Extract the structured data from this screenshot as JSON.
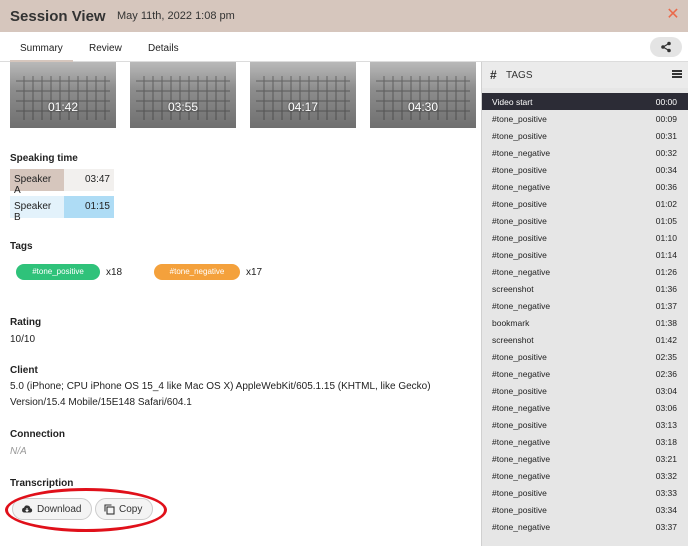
{
  "header": {
    "title": "Session View",
    "date": "May 11th, 2022 1:08 pm",
    "close_icon": "close-x-icon",
    "accent": "#ea6a4b"
  },
  "tabs": [
    {
      "label": "Summary",
      "active": true
    },
    {
      "label": "Review",
      "active": false
    },
    {
      "label": "Details",
      "active": false
    }
  ],
  "thumbnails": [
    "01:42",
    "03:55",
    "04:17",
    "04:30"
  ],
  "speaking_time": {
    "label": "Speaking time",
    "speakers": [
      {
        "name": "Speaker A",
        "duration": "03:47",
        "color": "#d6c6bd"
      },
      {
        "name": "Speaker B",
        "duration": "01:15",
        "color": "#aedcf5"
      }
    ]
  },
  "tags_summary": {
    "label": "Tags",
    "items": [
      {
        "name": "#tone_positive",
        "count": "x18",
        "color": "#2fc27a"
      },
      {
        "name": "#tone_negative",
        "count": "x17",
        "color": "#f4a13c"
      }
    ]
  },
  "rating": {
    "label": "Rating",
    "value": "10/10"
  },
  "client": {
    "label": "Client",
    "line1": "5.0 (iPhone; CPU iPhone OS 15_4 like Mac OS X) AppleWebKit/605.1.15 (KHTML, like Gecko)",
    "line2": "Version/15.4 Mobile/15E148 Safari/604.1"
  },
  "connection": {
    "label": "Connection",
    "value": "N/A"
  },
  "transcription": {
    "label": "Transcription",
    "download_label": "Download",
    "copy_label": "Copy"
  },
  "tags_panel": {
    "title": "TAGS",
    "rows": [
      {
        "name": "Video start",
        "time": "00:00",
        "active": true
      },
      {
        "name": "#tone_positive",
        "time": "00:09"
      },
      {
        "name": "#tone_positive",
        "time": "00:31"
      },
      {
        "name": "#tone_negative",
        "time": "00:32"
      },
      {
        "name": "#tone_positive",
        "time": "00:34"
      },
      {
        "name": "#tone_negative",
        "time": "00:36"
      },
      {
        "name": "#tone_positive",
        "time": "01:02"
      },
      {
        "name": "#tone_positive",
        "time": "01:05"
      },
      {
        "name": "#tone_positive",
        "time": "01:10"
      },
      {
        "name": "#tone_positive",
        "time": "01:14"
      },
      {
        "name": "#tone_negative",
        "time": "01:26"
      },
      {
        "name": "screenshot",
        "time": "01:36"
      },
      {
        "name": "#tone_negative",
        "time": "01:37"
      },
      {
        "name": "bookmark",
        "time": "01:38"
      },
      {
        "name": "screenshot",
        "time": "01:42"
      },
      {
        "name": "#tone_positive",
        "time": "02:35"
      },
      {
        "name": "#tone_negative",
        "time": "02:36"
      },
      {
        "name": "#tone_positive",
        "time": "03:04"
      },
      {
        "name": "#tone_negative",
        "time": "03:06"
      },
      {
        "name": "#tone_positive",
        "time": "03:13"
      },
      {
        "name": "#tone_negative",
        "time": "03:18"
      },
      {
        "name": "#tone_negative",
        "time": "03:21"
      },
      {
        "name": "#tone_negative",
        "time": "03:32"
      },
      {
        "name": "#tone_positive",
        "time": "03:33"
      },
      {
        "name": "#tone_positive",
        "time": "03:34"
      },
      {
        "name": "#tone_negative",
        "time": "03:37"
      }
    ]
  }
}
